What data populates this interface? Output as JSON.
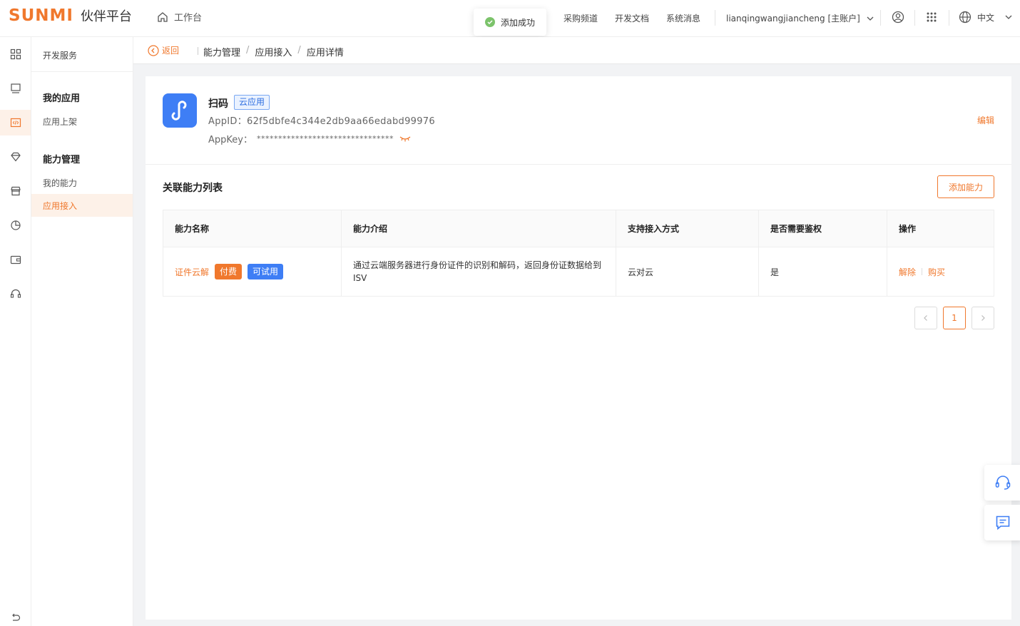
{
  "header": {
    "logo_brand": "SUNMI",
    "logo_title": "伙伴平台",
    "workbench": "工作台",
    "toast": "添加成功",
    "nav": [
      "采购频道",
      "开发文档",
      "系统消息"
    ],
    "account": "lianqingwangjiancheng [主账户]",
    "language": "中文"
  },
  "sidebar": {
    "service": "开发服务",
    "groups": [
      {
        "title": "我的应用",
        "items": [
          "应用上架"
        ]
      },
      {
        "title": "能力管理",
        "items": [
          "我的能力",
          "应用接入"
        ]
      }
    ]
  },
  "breadcrumb": {
    "back": "返回",
    "items": [
      "能力管理",
      "应用接入",
      "应用详情"
    ]
  },
  "app": {
    "name": "扫码",
    "tag": "云应用",
    "appid": "AppID：62f5dbfe4c344e2db9aa66edabd99976",
    "appkey_label": "AppKey：",
    "appkey_mask": "********************************",
    "edit": "编辑"
  },
  "abilities": {
    "title": "关联能力列表",
    "add_button": "添加能力",
    "columns": [
      "能力名称",
      "能力介绍",
      "支持接入方式",
      "是否需要鉴权",
      "操作"
    ],
    "rows": [
      {
        "name": "证件云解",
        "badges": [
          "付费",
          "可试用"
        ],
        "description": "通过云端服务器进行身份证件的识别和解码，返回身份证数据给到ISV",
        "access": "云对云",
        "auth": "是",
        "actions": [
          "解除",
          "购买"
        ]
      }
    ],
    "pagination": {
      "current": "1"
    }
  },
  "colors": {
    "accent": "#f0782d",
    "blue": "#3e7ef5",
    "success": "#7cc36b"
  }
}
